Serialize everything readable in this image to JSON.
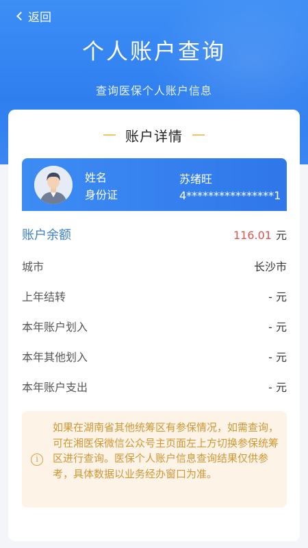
{
  "nav": {
    "back_label": "返回"
  },
  "header": {
    "title": "个人账户查询",
    "subtitle": "查询医保个人账户信息"
  },
  "card": {
    "heading": "账户详情"
  },
  "user": {
    "name_label": "姓名",
    "id_label": "身份证",
    "name_value": "苏绪旺",
    "id_value": "4****************1"
  },
  "balance": {
    "label": "账户余额",
    "amount": "116.01",
    "unit": "元"
  },
  "rows": [
    {
      "label": "城市",
      "value": "长沙市"
    },
    {
      "label": "上年结转",
      "value": "- 元"
    },
    {
      "label": "本年账户划入",
      "value": "- 元"
    },
    {
      "label": "本年其他划入",
      "value": "- 元"
    },
    {
      "label": "本年账户支出",
      "value": "- 元"
    }
  ],
  "notice": {
    "text": "如果在湖南省其他统筹区有参保情况，如需查询，可在湘医保微信公众号主页面左上方切换参保统筹区进行查询。医保个人账户信息查询结果仅供参考，具体数据以业务经办窗口为准。"
  },
  "colors": {
    "primary": "#2f7ff0",
    "amount": "#d9534f",
    "notice_text": "#d09634",
    "notice_bg": "#fdf3e6"
  }
}
